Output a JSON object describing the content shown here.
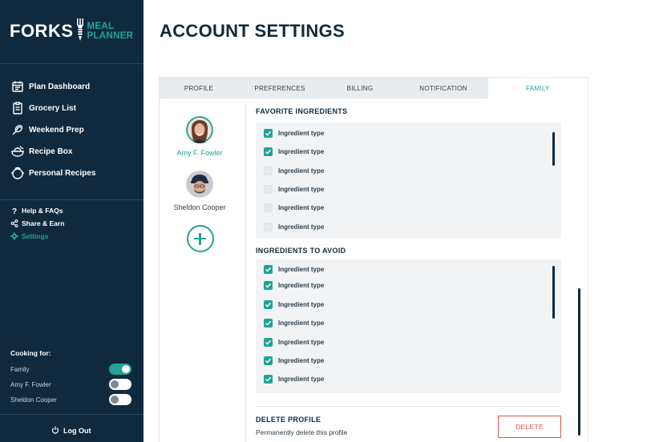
{
  "app": {
    "logo_main": "FORKS",
    "logo_sub_1": "MEAL",
    "logo_sub_2": "PLANNER",
    "accent_color": "#23a394",
    "sidebar_color": "#0f2a3f",
    "danger_color": "#e0524c"
  },
  "sidebar": {
    "nav": [
      {
        "label": "Plan Dashboard",
        "icon": "calendar-icon"
      },
      {
        "label": "Grocery List",
        "icon": "list-icon"
      },
      {
        "label": "Weekend Prep",
        "icon": "whisk-icon"
      },
      {
        "label": "Recipe Box",
        "icon": "bowl-icon"
      },
      {
        "label": "Personal Recipes",
        "icon": "pot-icon"
      }
    ],
    "secondary": [
      {
        "label": "Help & FAQs",
        "icon": "question-icon"
      },
      {
        "label": "Share & Earn",
        "icon": "share-icon"
      },
      {
        "label": "Settings",
        "icon": "gear-icon",
        "active": true
      }
    ],
    "cooking_for": {
      "title": "Cooking for:",
      "rows": [
        {
          "label": "Family",
          "on": true
        },
        {
          "label": "Amy F. Fowler",
          "on": false
        },
        {
          "label": "Sheldon Cooper",
          "on": false
        }
      ]
    },
    "logout_label": "Log Out"
  },
  "main": {
    "title": "ACCOUNT SETTINGS",
    "tabs": [
      {
        "label": "PROFILE"
      },
      {
        "label": "PREFERENCES"
      },
      {
        "label": "BILLING"
      },
      {
        "label": "NOTIFICATION"
      },
      {
        "label": "FAMILY",
        "active": true
      }
    ],
    "profiles": [
      {
        "name": "Amy F. Fowler",
        "active": true
      },
      {
        "name": "Sheldon Cooper",
        "active": false
      }
    ],
    "favorite": {
      "title": "FAVORITE INGREDIENTS",
      "items": [
        {
          "label": "Ingredient type",
          "checked": true
        },
        {
          "label": "Ingredient type",
          "checked": true
        },
        {
          "label": "Ingredient type",
          "checked": false
        },
        {
          "label": "Ingredient type",
          "checked": false
        },
        {
          "label": "Ingredient type",
          "checked": false
        },
        {
          "label": "Ingredient type",
          "checked": false
        }
      ]
    },
    "avoid": {
      "title": "INGREDIENTS TO AVOID",
      "items": [
        {
          "label": "Ingredient type",
          "checked": true
        },
        {
          "label": "Ingredient type",
          "checked": true
        },
        {
          "label": "Ingredient type",
          "checked": true
        },
        {
          "label": "Ingredient type",
          "checked": true
        },
        {
          "label": "Ingredient type",
          "checked": true
        },
        {
          "label": "Ingredient type",
          "checked": true
        },
        {
          "label": "Ingredient type",
          "checked": true
        }
      ]
    },
    "delete_profile": {
      "title": "DELETE PROFILE",
      "description": "Permanently delete this profile",
      "button": "DELETE"
    }
  }
}
